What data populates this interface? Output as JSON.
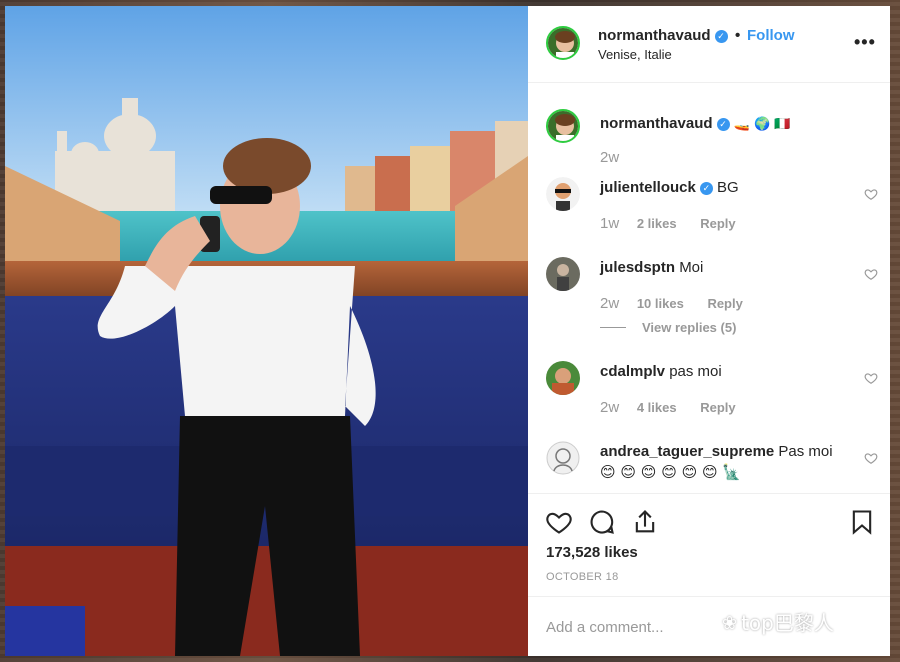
{
  "post": {
    "author": "normanthavaud",
    "follow_label": "Follow",
    "separator": "•",
    "location": "Venise, Italie",
    "more_icon": "more-horizontal-icon"
  },
  "caption": {
    "user": "normanthavaud",
    "text": "🚤 🌍 🇮🇹",
    "age": "2w"
  },
  "comments": [
    {
      "user": "julientellouck",
      "text": "BG",
      "age": "1w",
      "likes": "2 likes",
      "reply": "Reply",
      "verified": true
    },
    {
      "user": "julesdsptn",
      "text": "Moi",
      "age": "2w",
      "likes": "10 likes",
      "reply": "Reply",
      "view_replies": "View replies (5)"
    },
    {
      "user": "cdalmplv",
      "text": "pas moi",
      "age": "2w",
      "likes": "4 likes",
      "reply": "Reply"
    },
    {
      "user": "andrea_taguer_supreme",
      "text": "Pas moi",
      "emoji_line": "😊 😊 😊 😊 😊 😊 🗽"
    }
  ],
  "actions": {
    "like_icon": "heart-icon",
    "comment_icon": "comment-icon",
    "share_icon": "share-icon",
    "save_icon": "bookmark-icon",
    "likes_count": "173,528 likes",
    "date": "OCTOBER 18"
  },
  "add_comment": {
    "placeholder": "Add a comment..."
  },
  "watermark": {
    "text": "top巴黎人"
  },
  "colors": {
    "link_blue": "#3897f0",
    "verified_blue": "#3897f0",
    "muted": "#999999",
    "text": "#262626"
  }
}
